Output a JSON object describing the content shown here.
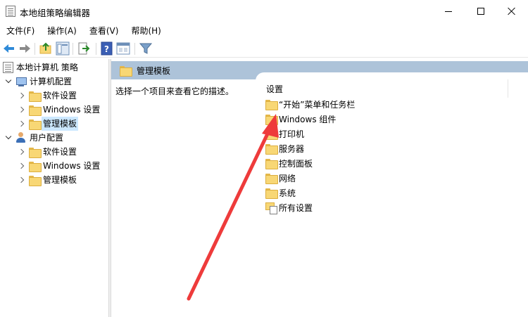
{
  "window": {
    "title": "本地组策略编辑器"
  },
  "menu": [
    "文件(F)",
    "操作(A)",
    "查看(V)",
    "帮助(H)"
  ],
  "toolbar": {
    "icons": [
      "back-arrow-icon",
      "forward-arrow-icon",
      "up-folder-icon",
      "show-hide-tree-icon",
      "export-list-icon",
      "help-icon",
      "properties-icon",
      "filter-icon"
    ]
  },
  "tree": {
    "root": "本地计算机 策略",
    "computer": "计算机配置",
    "computer_children": [
      "软件设置",
      "Windows 设置",
      "管理模板"
    ],
    "user": "用户配置",
    "user_children": [
      "软件设置",
      "Windows 设置",
      "管理模板"
    ]
  },
  "right": {
    "header": "管理模板",
    "description": "选择一个项目来查看它的描述。",
    "column_header": "设置",
    "items": [
      "“开始”菜单和任务栏",
      "Windows 组件",
      "打印机",
      "服务器",
      "控制面板",
      "网络",
      "系统",
      "所有设置"
    ]
  },
  "annotation": {
    "arrow_color": "#ee3b3b"
  }
}
